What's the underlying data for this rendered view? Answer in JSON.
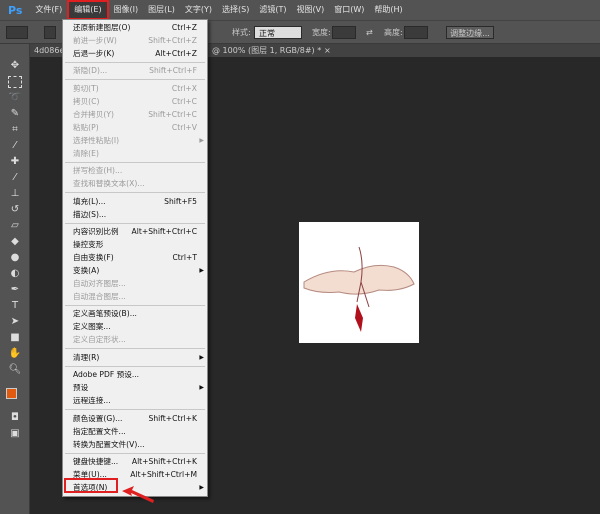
{
  "app": {
    "logo": "Ps"
  },
  "menubar": [
    {
      "label": "文件(F)"
    },
    {
      "label": "编辑(E)",
      "active": true
    },
    {
      "label": "图像(I)"
    },
    {
      "label": "图层(L)"
    },
    {
      "label": "文字(Y)"
    },
    {
      "label": "选择(S)"
    },
    {
      "label": "滤镜(T)"
    },
    {
      "label": "视图(V)"
    },
    {
      "label": "窗口(W)"
    },
    {
      "label": "帮助(H)"
    }
  ],
  "options": {
    "style_label": "样式:",
    "style_value": "正常",
    "width_label": "宽度:",
    "height_label": "高度:",
    "refine_button": "调整边缘..."
  },
  "tabs": {
    "doc1": "4d086e",
    "doc2": "@ 100% (图层 1, RGB/8#) *",
    "close": "×"
  },
  "edit_menu": [
    {
      "label": "还原新建图层(O)",
      "shortcut": "Ctrl+Z"
    },
    {
      "label": "前进一步(W)",
      "shortcut": "Shift+Ctrl+Z",
      "disabled": true
    },
    {
      "label": "后退一步(K)",
      "shortcut": "Alt+Ctrl+Z"
    },
    {
      "sep": true
    },
    {
      "label": "渐隐(D)...",
      "shortcut": "Shift+Ctrl+F",
      "disabled": true
    },
    {
      "sep": true
    },
    {
      "label": "剪切(T)",
      "shortcut": "Ctrl+X",
      "disabled": true
    },
    {
      "label": "拷贝(C)",
      "shortcut": "Ctrl+C",
      "disabled": true
    },
    {
      "label": "合并拷贝(Y)",
      "shortcut": "Shift+Ctrl+C",
      "disabled": true
    },
    {
      "label": "粘贴(P)",
      "shortcut": "Ctrl+V",
      "disabled": true
    },
    {
      "label": "选择性粘贴(I)",
      "submenu": true,
      "disabled": true
    },
    {
      "label": "清除(E)",
      "disabled": true
    },
    {
      "sep": true
    },
    {
      "label": "拼写检查(H)...",
      "disabled": true
    },
    {
      "label": "查找和替换文本(X)...",
      "disabled": true
    },
    {
      "sep": true
    },
    {
      "label": "填充(L)...",
      "shortcut": "Shift+F5"
    },
    {
      "label": "描边(S)..."
    },
    {
      "sep": true
    },
    {
      "label": "内容识别比例",
      "shortcut": "Alt+Shift+Ctrl+C"
    },
    {
      "label": "操控变形"
    },
    {
      "label": "自由变换(F)",
      "shortcut": "Ctrl+T"
    },
    {
      "label": "变换(A)",
      "submenu": true
    },
    {
      "label": "自动对齐图层...",
      "disabled": true
    },
    {
      "label": "自动混合图层...",
      "disabled": true
    },
    {
      "sep": true
    },
    {
      "label": "定义画笔预设(B)..."
    },
    {
      "label": "定义图案..."
    },
    {
      "label": "定义自定形状...",
      "disabled": true
    },
    {
      "sep": true
    },
    {
      "label": "清理(R)",
      "submenu": true
    },
    {
      "sep": true
    },
    {
      "label": "Adobe PDF 预设..."
    },
    {
      "label": "预设",
      "submenu": true
    },
    {
      "label": "远程连接..."
    },
    {
      "sep": true
    },
    {
      "label": "颜色设置(G)...",
      "shortcut": "Shift+Ctrl+K"
    },
    {
      "label": "指定配置文件..."
    },
    {
      "label": "转换为配置文件(V)..."
    },
    {
      "sep": true
    },
    {
      "label": "键盘快捷键...",
      "shortcut": "Alt+Shift+Ctrl+K"
    },
    {
      "label": "菜单(U)...",
      "shortcut": "Alt+Shift+Ctrl+M"
    },
    {
      "label": "首选项(N)",
      "submenu": true
    }
  ],
  "colors": {
    "highlight": "#e02020",
    "foreground": "#e05a10",
    "background": "#ffffff"
  }
}
